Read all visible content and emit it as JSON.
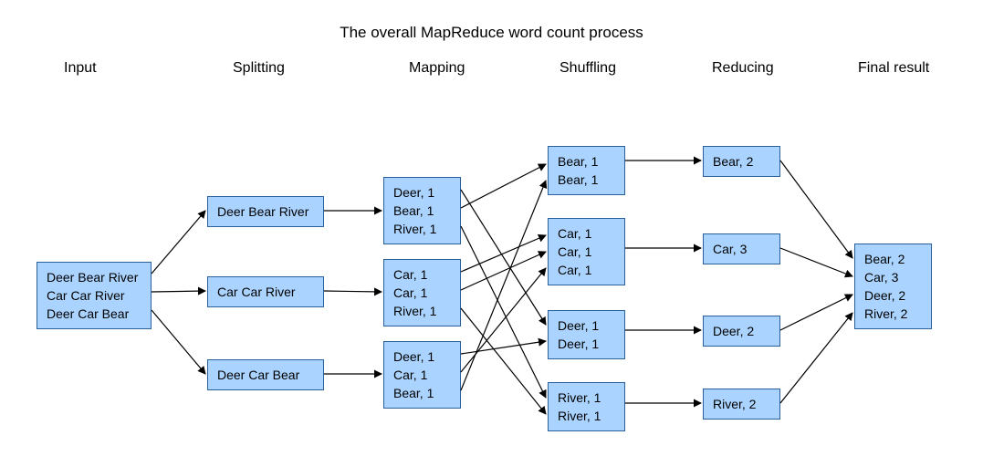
{
  "title": "The overall MapReduce word count process",
  "stages": {
    "input": "Input",
    "splitting": "Splitting",
    "mapping": "Mapping",
    "shuffling": "Shuffling",
    "reducing": "Reducing",
    "final": "Final result"
  },
  "input_box": "Deer Bear River\nCar Car River\nDeer Car Bear",
  "splitting_boxes": [
    "Deer Bear River",
    "Car Car River",
    "Deer Car Bear"
  ],
  "mapping_boxes": [
    "Deer, 1\nBear, 1\nRiver, 1",
    "Car, 1\nCar, 1\nRiver, 1",
    "Deer, 1\nCar, 1\nBear, 1"
  ],
  "shuffling_boxes": [
    "Bear, 1\nBear, 1",
    "Car, 1\nCar, 1\nCar, 1",
    "Deer, 1\nDeer, 1",
    "River, 1\nRiver, 1"
  ],
  "reducing_boxes": [
    "Bear, 2",
    "Car, 3",
    "Deer, 2",
    "River, 2"
  ],
  "final_box": "Bear, 2\nCar, 3\nDeer, 2\nRiver, 2"
}
